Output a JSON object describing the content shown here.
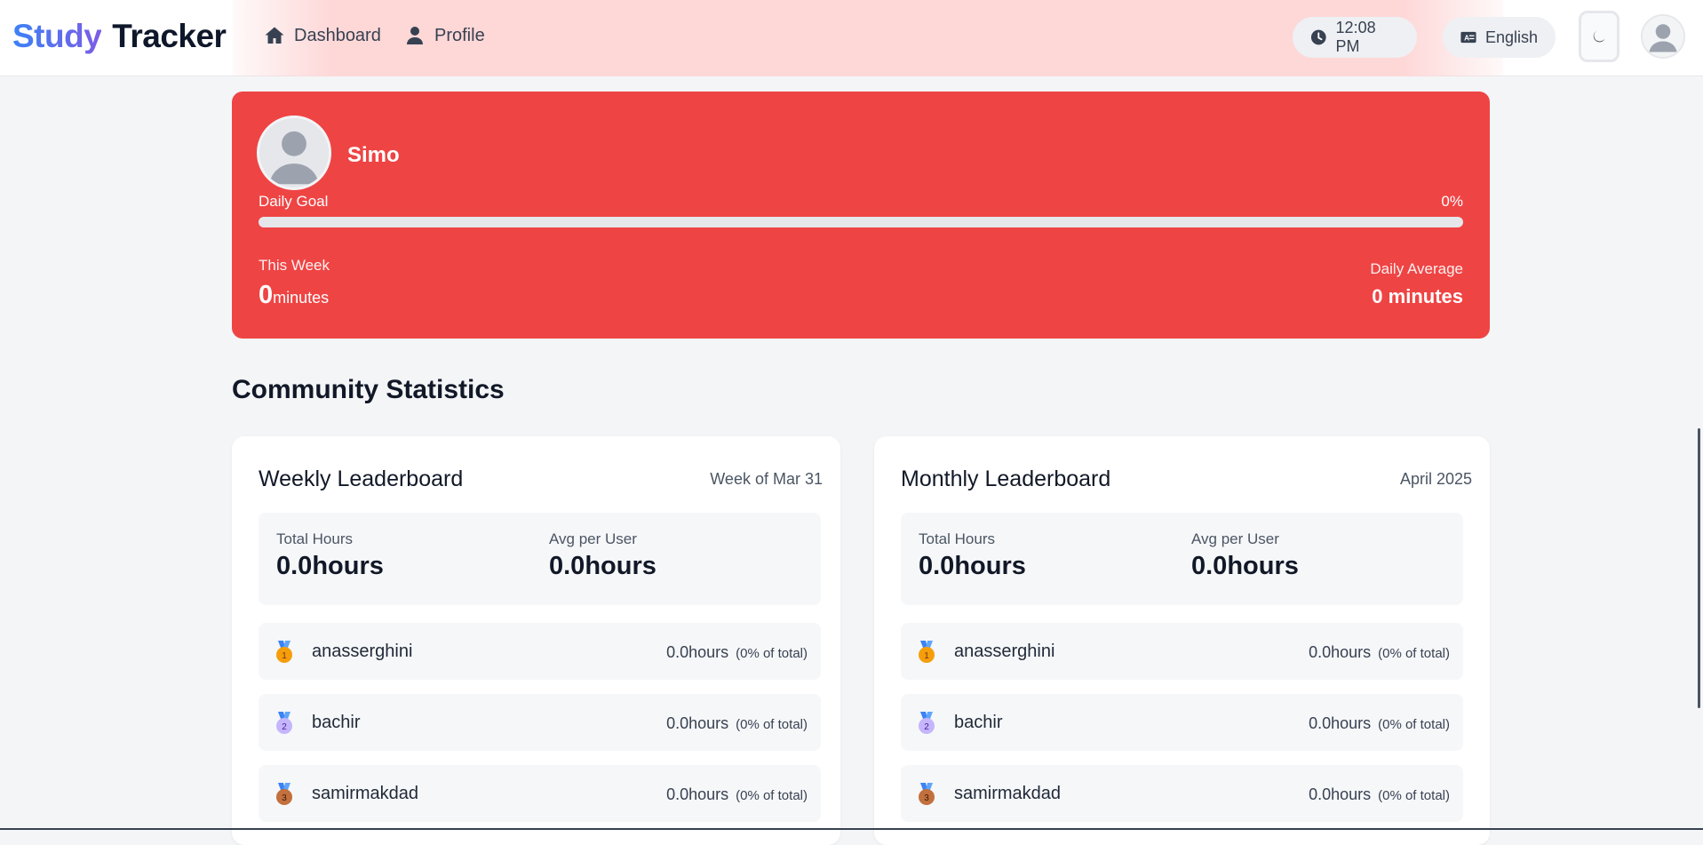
{
  "brand": {
    "part1": "Study",
    "part2": "Tracker"
  },
  "nav": [
    {
      "label": "Dashboard",
      "icon": "home-icon"
    },
    {
      "label": "Profile",
      "icon": "user-icon"
    }
  ],
  "header": {
    "time": "12:08 PM",
    "language": "English",
    "theme_icon": "moon-icon",
    "avatar_icon": "user-avatar-icon"
  },
  "profile": {
    "name": "Simo",
    "daily_goal_label": "Daily Goal",
    "daily_goal_percent": "0%",
    "daily_goal_fraction": 0,
    "this_week_label": "This Week",
    "this_week_value": "0",
    "this_week_unit": "minutes",
    "daily_average_label": "Daily Average",
    "daily_average_value": "0 minutes"
  },
  "section_title": "Community Statistics",
  "weekly": {
    "title": "Weekly Leaderboard",
    "period": "Week of Mar 31",
    "total_label": "Total Hours",
    "total_value": "0.0hours",
    "avg_label": "Avg per User",
    "avg_value": "0.0hours",
    "rows": [
      {
        "rank": "1",
        "name": "anasserghini",
        "hours": "0.0hours",
        "pct": "(0% of total)"
      },
      {
        "rank": "2",
        "name": "bachir",
        "hours": "0.0hours",
        "pct": "(0% of total)"
      },
      {
        "rank": "3",
        "name": "samirmakdad",
        "hours": "0.0hours",
        "pct": "(0% of total)"
      }
    ]
  },
  "monthly": {
    "title": "Monthly Leaderboard",
    "period": "April 2025",
    "total_label": "Total Hours",
    "total_value": "0.0hours",
    "avg_label": "Avg per User",
    "avg_value": "0.0hours",
    "rows": [
      {
        "rank": "1",
        "name": "anasserghini",
        "hours": "0.0hours",
        "pct": "(0% of total)"
      },
      {
        "rank": "2",
        "name": "bachir",
        "hours": "0.0hours",
        "pct": "(0% of total)"
      },
      {
        "rank": "3",
        "name": "samirmakdad",
        "hours": "0.0hours",
        "pct": "(0% of total)"
      }
    ]
  },
  "colors": {
    "accent_red": "#ef4444",
    "brand_blue": "#3b82f6",
    "brand_purple": "#7c5ce6",
    "medal_gold": "#f59e0b",
    "medal_silver": "#c4b5fd",
    "medal_bronze": "#c2703d"
  }
}
